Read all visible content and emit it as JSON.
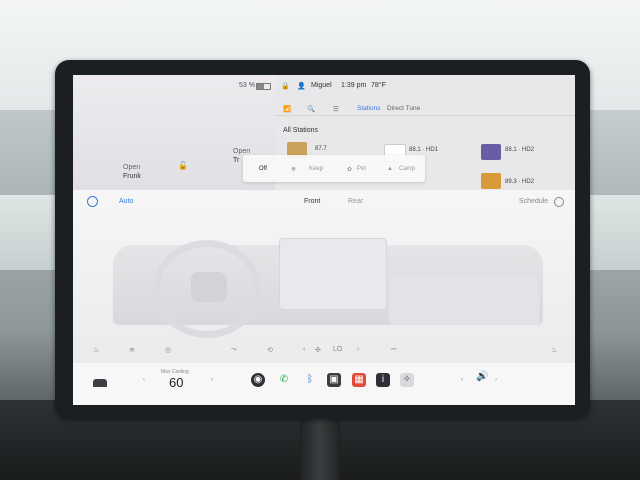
{
  "status": {
    "battery": "53 %",
    "user": "Miguel",
    "time": "1:39 pm",
    "temperature": "78°F"
  },
  "car": {
    "frunk": [
      "Open",
      "Frunk"
    ],
    "trunk": [
      "Open",
      "Tr"
    ]
  },
  "media": {
    "tabs": [
      "Stations",
      "Direct Tune"
    ],
    "section_title": "All Stations",
    "stations": [
      {
        "name": "87.7"
      },
      {
        "name": "88.1 · HD1"
      },
      {
        "name": "88.1 · HD2"
      },
      {
        "name": "89.3 · HD2"
      }
    ]
  },
  "climate_popup": {
    "options": [
      "Off",
      "Keep",
      "Pet",
      "Camp"
    ],
    "selected": "Off"
  },
  "climate": {
    "auto": "Auto",
    "front": "Front",
    "rear": "Rear",
    "schedule": "Schedule",
    "fan_value": "LO",
    "colors": {
      "accent": "#3b78d6"
    }
  },
  "dock": {
    "temp_label": "Max Cooling",
    "temp_value": "60"
  }
}
